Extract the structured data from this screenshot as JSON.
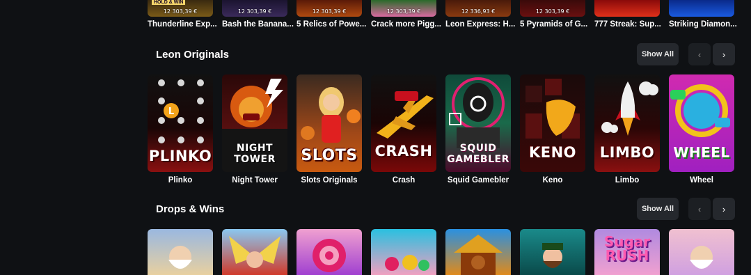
{
  "top_games": [
    {
      "title": "Thunderline Exp...",
      "jackpot": "12 303,39 €",
      "tag": "HOLD & WIN"
    },
    {
      "title": "Bash the Banana...",
      "jackpot": "12 303,39 €",
      "tag": ""
    },
    {
      "title": "5 Relics of Powe...",
      "jackpot": "12 303,39 €",
      "tag": ""
    },
    {
      "title": "Crack more Pigg...",
      "jackpot": "12 303,39 €",
      "tag": ""
    },
    {
      "title": "Leon Express: H...",
      "jackpot": "12 336,93 €",
      "tag": ""
    },
    {
      "title": "5 Pyramids of G...",
      "jackpot": "12 303,39 €",
      "tag": ""
    },
    {
      "title": "777 Streak: Sup...",
      "jackpot": "",
      "tag": ""
    },
    {
      "title": "Striking Diamon...",
      "jackpot": "",
      "tag": ""
    }
  ],
  "leon_originals": {
    "title": "Leon Originals",
    "show_all": "Show All",
    "prev_icon": "‹",
    "next_icon": "›",
    "games": [
      {
        "label": "Plinko",
        "art_text": "PLINKO"
      },
      {
        "label": "Night Tower",
        "art_text": "NIGHT TOWER"
      },
      {
        "label": "Slots Originals",
        "art_text": "SLOTS"
      },
      {
        "label": "Crash",
        "art_text": "CRASH"
      },
      {
        "label": "Squid Gamebler",
        "art_text": "SQUID GAMEBLER"
      },
      {
        "label": "Keno",
        "art_text": "KENO"
      },
      {
        "label": "Limbo",
        "art_text": "LIMBO"
      },
      {
        "label": "Wheel",
        "art_text": "WHEEL"
      }
    ]
  },
  "drops_wins": {
    "title": "Drops & Wins",
    "show_all": "Show All",
    "prev_icon": "‹",
    "next_icon": "›",
    "games": [
      {
        "art_text": ""
      },
      {
        "art_text": ""
      },
      {
        "art_text": ""
      },
      {
        "art_text": ""
      },
      {
        "art_text": ""
      },
      {
        "art_text": ""
      },
      {
        "art_text": "Sugar RUSH"
      },
      {
        "art_text": ""
      }
    ]
  },
  "colors": {
    "background": "#0f1114",
    "button": "#25282d",
    "accent_red": "#c8101e"
  }
}
